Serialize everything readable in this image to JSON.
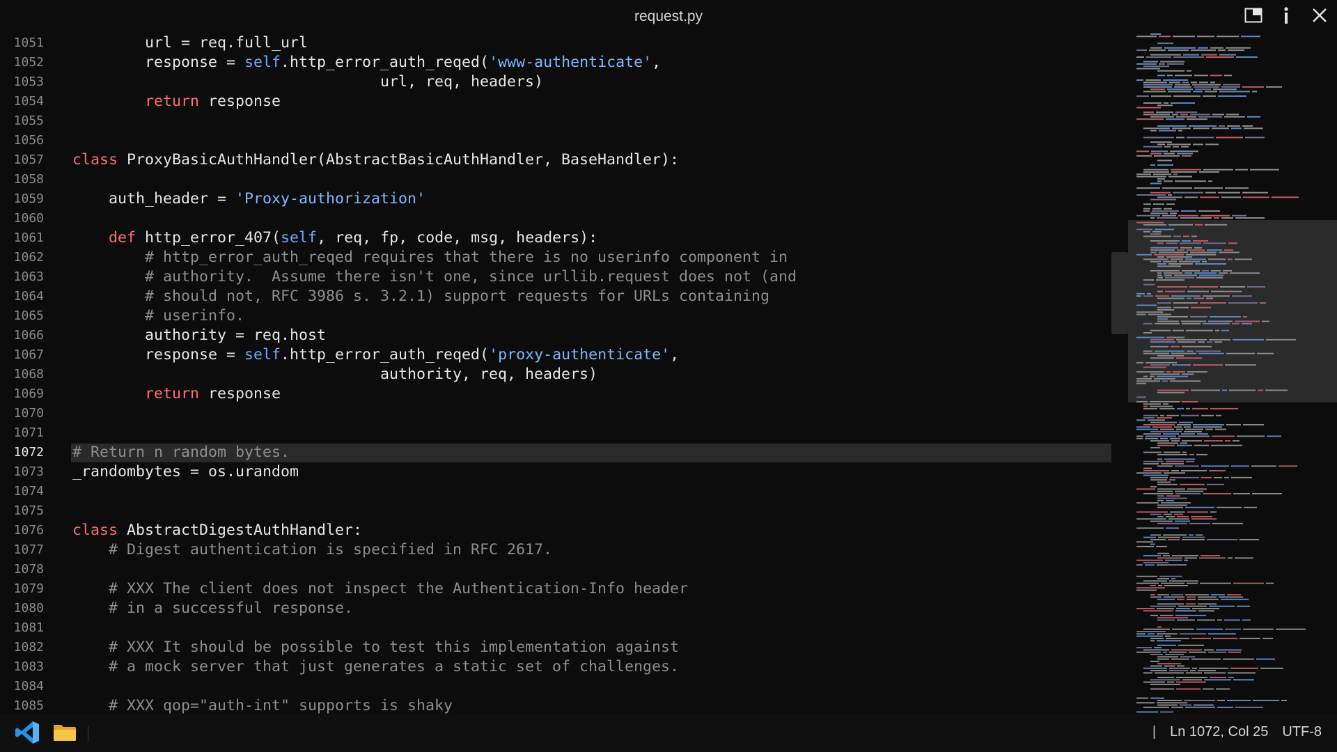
{
  "window": {
    "title": "request.py",
    "buttons": {
      "layout_icon": "panel-layout-icon",
      "info_icon": "info-icon",
      "close_icon": "close-icon"
    }
  },
  "editor": {
    "current_line": "1072",
    "lines": [
      {
        "n": "1051",
        "indent": "        ",
        "tokens": [
          [
            "",
            "url = req.full_url"
          ]
        ]
      },
      {
        "n": "1052",
        "indent": "        ",
        "tokens": [
          [
            "",
            "response = "
          ],
          [
            "sf",
            "self"
          ],
          [
            "",
            ".http_error_auth_reqed("
          ],
          [
            "st",
            "'www-authenticate'"
          ],
          [
            "",
            ","
          ]
        ]
      },
      {
        "n": "1053",
        "indent": "                                  ",
        "tokens": [
          [
            "",
            "url, req, headers)"
          ]
        ]
      },
      {
        "n": "1054",
        "indent": "        ",
        "tokens": [
          [
            "kw",
            "return"
          ],
          [
            "",
            " response"
          ]
        ]
      },
      {
        "n": "1055",
        "indent": "",
        "tokens": []
      },
      {
        "n": "1056",
        "indent": "",
        "tokens": []
      },
      {
        "n": "1057",
        "indent": "",
        "tokens": [
          [
            "kw",
            "class"
          ],
          [
            "",
            " ProxyBasicAuthHandler(AbstractBasicAuthHandler, BaseHandler):"
          ]
        ]
      },
      {
        "n": "1058",
        "indent": "",
        "tokens": []
      },
      {
        "n": "1059",
        "indent": "    ",
        "tokens": [
          [
            "",
            "auth_header = "
          ],
          [
            "st",
            "'Proxy-authorization'"
          ]
        ]
      },
      {
        "n": "1060",
        "indent": "",
        "tokens": []
      },
      {
        "n": "1061",
        "indent": "    ",
        "tokens": [
          [
            "kw",
            "def"
          ],
          [
            "",
            " http_error_407("
          ],
          [
            "sf",
            "self"
          ],
          [
            "",
            ", req, fp, code, msg, headers):"
          ]
        ]
      },
      {
        "n": "1062",
        "indent": "        ",
        "tokens": [
          [
            "cm",
            "# http_error_auth_reqed requires that there is no userinfo component in"
          ]
        ]
      },
      {
        "n": "1063",
        "indent": "        ",
        "tokens": [
          [
            "cm",
            "# authority.  Assume there isn't one, since urllib.request does not (and"
          ]
        ]
      },
      {
        "n": "1064",
        "indent": "        ",
        "tokens": [
          [
            "cm",
            "# should not, RFC 3986 s. 3.2.1) support requests for URLs containing"
          ]
        ]
      },
      {
        "n": "1065",
        "indent": "        ",
        "tokens": [
          [
            "cm",
            "# userinfo."
          ]
        ]
      },
      {
        "n": "1066",
        "indent": "        ",
        "tokens": [
          [
            "",
            "authority = req.host"
          ]
        ]
      },
      {
        "n": "1067",
        "indent": "        ",
        "tokens": [
          [
            "",
            "response = "
          ],
          [
            "sf",
            "self"
          ],
          [
            "",
            ".http_error_auth_reqed("
          ],
          [
            "st",
            "'proxy-authenticate'"
          ],
          [
            "",
            ","
          ]
        ]
      },
      {
        "n": "1068",
        "indent": "                                  ",
        "tokens": [
          [
            "",
            "authority, req, headers)"
          ]
        ]
      },
      {
        "n": "1069",
        "indent": "        ",
        "tokens": [
          [
            "kw",
            "return"
          ],
          [
            "",
            " response"
          ]
        ]
      },
      {
        "n": "1070",
        "indent": "",
        "tokens": []
      },
      {
        "n": "1071",
        "indent": "",
        "tokens": []
      },
      {
        "n": "1072",
        "indent": "",
        "tokens": [
          [
            "cm",
            "# Return n random bytes."
          ]
        ]
      },
      {
        "n": "1073",
        "indent": "",
        "tokens": [
          [
            "",
            "_randombytes = os.urandom"
          ]
        ]
      },
      {
        "n": "1074",
        "indent": "",
        "tokens": []
      },
      {
        "n": "1075",
        "indent": "",
        "tokens": []
      },
      {
        "n": "1076",
        "indent": "",
        "tokens": [
          [
            "kw",
            "class"
          ],
          [
            "",
            " AbstractDigestAuthHandler:"
          ]
        ]
      },
      {
        "n": "1077",
        "indent": "    ",
        "tokens": [
          [
            "cm",
            "# Digest authentication is specified in RFC 2617."
          ]
        ]
      },
      {
        "n": "1078",
        "indent": "",
        "tokens": []
      },
      {
        "n": "1079",
        "indent": "    ",
        "tokens": [
          [
            "cm",
            "# XXX The client does not inspect the Authentication-Info header"
          ]
        ]
      },
      {
        "n": "1080",
        "indent": "    ",
        "tokens": [
          [
            "cm",
            "# in a successful response."
          ]
        ]
      },
      {
        "n": "1081",
        "indent": "",
        "tokens": []
      },
      {
        "n": "1082",
        "indent": "    ",
        "tokens": [
          [
            "cm",
            "# XXX It should be possible to test this implementation against"
          ]
        ]
      },
      {
        "n": "1083",
        "indent": "    ",
        "tokens": [
          [
            "cm",
            "# a mock server that just generates a static set of challenges."
          ]
        ]
      },
      {
        "n": "1084",
        "indent": "",
        "tokens": []
      },
      {
        "n": "1085",
        "indent": "    ",
        "tokens": [
          [
            "cm",
            "# XXX qop=\"auth-int\" supports is shaky"
          ]
        ]
      }
    ]
  },
  "colors": {
    "keyword": "#ff6b6b",
    "self": "#6aaaff",
    "string": "#7fb7ff",
    "comment": "#8d8d8d",
    "text": "#e6e6e6"
  },
  "statusbar": {
    "app_icon": "vscode-icon",
    "folder_icon": "folder-icon",
    "separator": "|",
    "position": "Ln 1072, Col 25",
    "encoding": "UTF-8"
  }
}
